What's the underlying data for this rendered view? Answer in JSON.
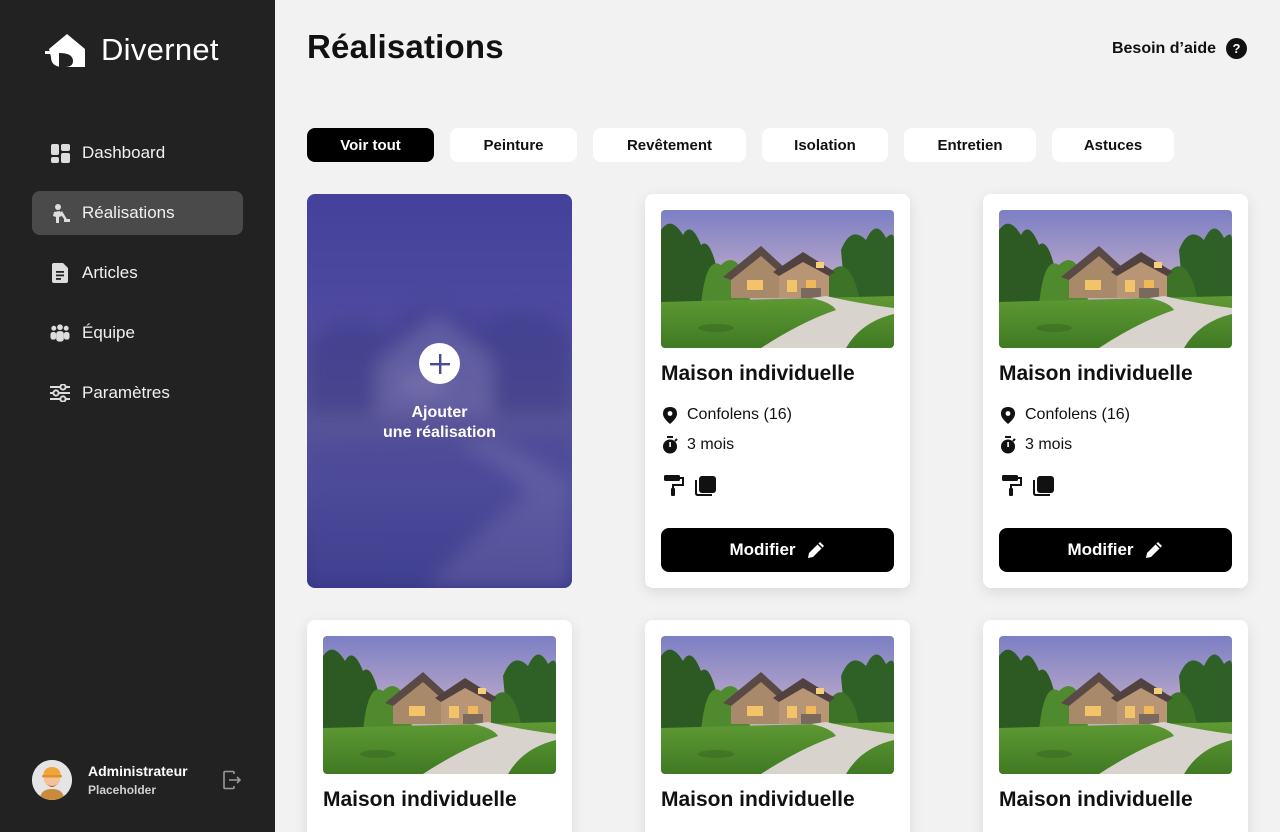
{
  "brand": {
    "name": "Divernet"
  },
  "sidebar": {
    "items": [
      {
        "label": "Dashboard",
        "icon": "dashboard-icon",
        "active": false
      },
      {
        "label": "Réalisations",
        "icon": "worker-icon",
        "active": true
      },
      {
        "label": "Articles",
        "icon": "document-icon",
        "active": false
      },
      {
        "label": "Équipe",
        "icon": "team-icon",
        "active": false
      },
      {
        "label": "Paramètres",
        "icon": "sliders-icon",
        "active": false
      }
    ],
    "user": {
      "name": "Administrateur",
      "role": "Placeholder"
    }
  },
  "header": {
    "title": "Réalisations",
    "help_label": "Besoin d’aide",
    "help_icon_text": "?"
  },
  "filters": [
    {
      "label": "Voir tout",
      "active": true
    },
    {
      "label": "Peinture",
      "active": false
    },
    {
      "label": "Revêtement",
      "active": false
    },
    {
      "label": "Isolation",
      "active": false
    },
    {
      "label": "Entretien",
      "active": false
    },
    {
      "label": "Astuces",
      "active": false
    }
  ],
  "add_card": {
    "line1": "Ajouter",
    "line2": "une réalisation"
  },
  "projects": [
    {
      "title": "Maison individuelle",
      "location": "Confolens (16)",
      "duration": "3 mois",
      "button": "Modifier",
      "tools": [
        "paint-roller-icon",
        "coating-icon"
      ]
    },
    {
      "title": "Maison individuelle",
      "location": "Confolens (16)",
      "duration": "3 mois",
      "button": "Modifier",
      "tools": [
        "paint-roller-icon",
        "coating-icon"
      ]
    },
    {
      "title": "Maison individuelle",
      "location": "",
      "duration": "",
      "button": "",
      "tools": []
    },
    {
      "title": "Maison individuelle",
      "location": "",
      "duration": "",
      "button": "",
      "tools": []
    },
    {
      "title": "Maison individuelle",
      "location": "",
      "duration": "",
      "button": "",
      "tools": []
    }
  ],
  "colors": {
    "sidebar_bg": "#222222",
    "active_nav_bg": "#4a4a4a",
    "page_bg": "#f2f2f2",
    "add_card": "#4b4aa0",
    "primary_button": "#000000"
  }
}
